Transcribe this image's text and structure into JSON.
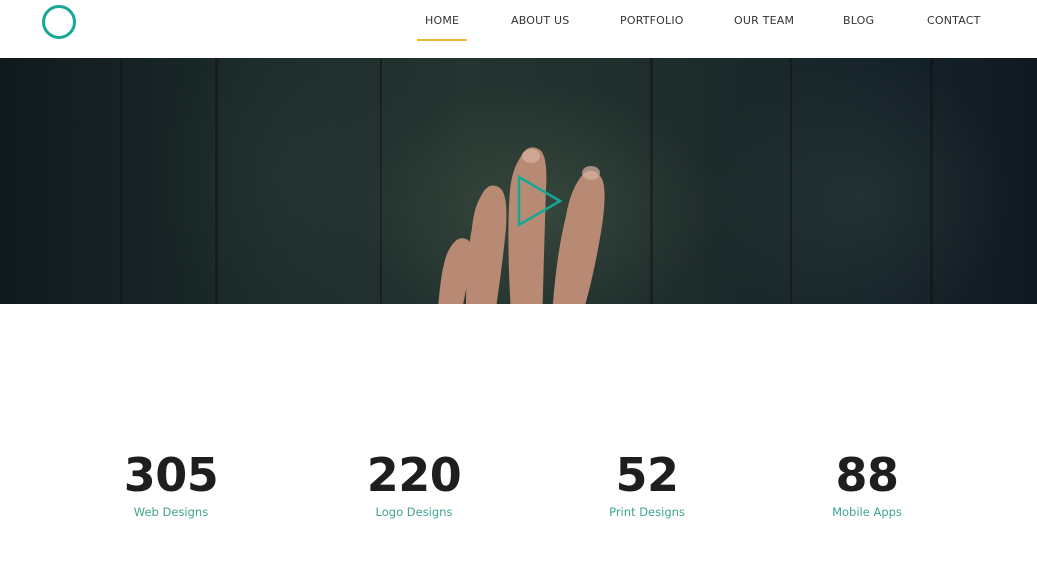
{
  "colors": {
    "accent": "#17a797",
    "active_underline": "#f1b42f",
    "stat_label": "#3fa590",
    "stat_number": "#1e1e1e"
  },
  "logo": {
    "icon": "ring-logo-icon"
  },
  "nav": {
    "items": [
      {
        "label": "HOME",
        "active": true
      },
      {
        "label": "ABOUT US",
        "active": false
      },
      {
        "label": "PORTFOLIO",
        "active": false
      },
      {
        "label": "OUR TEAM",
        "active": false
      },
      {
        "label": "BLOG",
        "active": false
      },
      {
        "label": "CONTACT",
        "active": false
      }
    ]
  },
  "hero": {
    "play_icon": "play-icon"
  },
  "stats": [
    {
      "number": "305",
      "label": "Web Designs"
    },
    {
      "number": "220",
      "label": "Logo Designs"
    },
    {
      "number": "52",
      "label": "Print Designs"
    },
    {
      "number": "88",
      "label": "Mobile Apps"
    }
  ]
}
